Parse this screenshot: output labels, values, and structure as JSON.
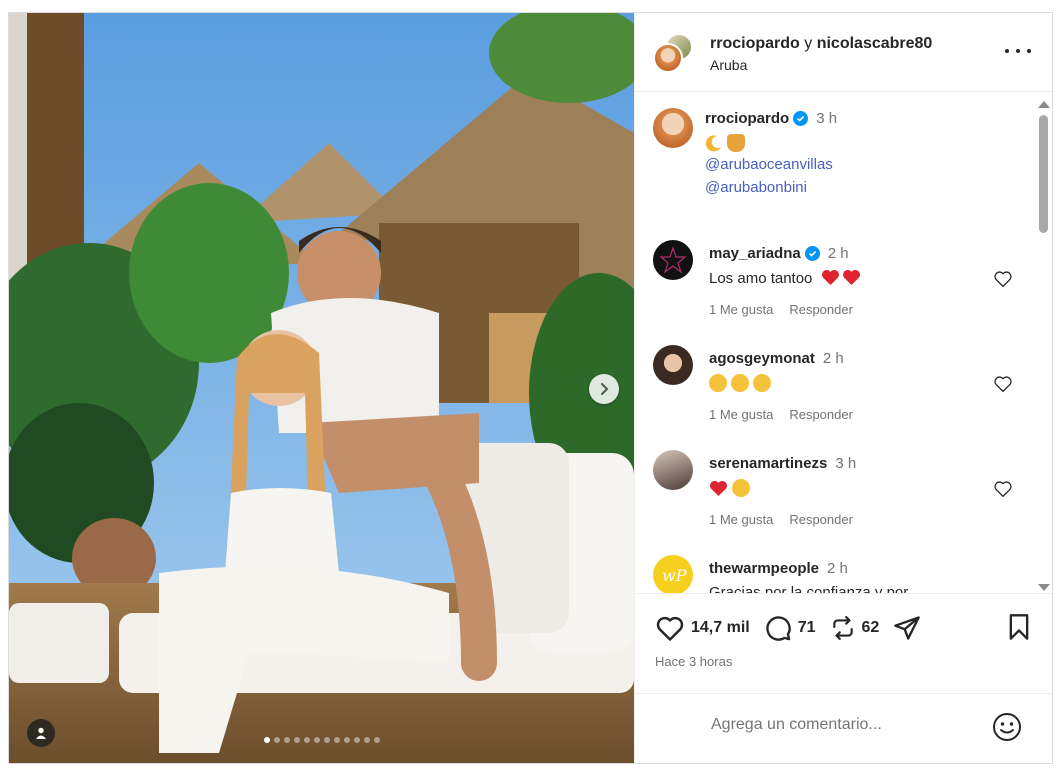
{
  "post": {
    "header": {
      "author_1": "rrociopardo",
      "connector": "y",
      "author_2": "nicolascabre80",
      "location": "Aruba"
    },
    "carousel": {
      "total_slides": 12,
      "active_slide": 1
    },
    "caption": {
      "username": "rrociopardo",
      "verified": true,
      "time": "3 h",
      "emojis": [
        "crescent-moon",
        "pot-of-honey"
      ],
      "mentions": [
        "@arubaoceanvillas",
        "@arubabonbini"
      ]
    },
    "comments": [
      {
        "username": "may_ariadna",
        "verified": true,
        "time": "2 h",
        "text": "Los amo tantoo",
        "emojis": [
          "red-heart",
          "red-heart"
        ],
        "likes": "1 Me gusta",
        "reply": "Responder"
      },
      {
        "username": "agosgeymonat",
        "verified": false,
        "time": "2 h",
        "text": "",
        "emojis": [
          "heart-eyes",
          "heart-eyes",
          "heart-eyes"
        ],
        "likes": "1 Me gusta",
        "reply": "Responder"
      },
      {
        "username": "serenamartinezs",
        "verified": false,
        "time": "3 h",
        "text": "",
        "emojis": [
          "red-heart",
          "heart-eyes"
        ],
        "likes": "1 Me gusta",
        "reply": "Responder"
      },
      {
        "username": "thewarmpeople",
        "verified": false,
        "time": "2 h",
        "text": "Gracias por la confianza y por",
        "emojis": [],
        "likes": "",
        "reply": ""
      }
    ],
    "actions": {
      "likes": "14,7 mil",
      "comments": "71",
      "reposts": "62"
    },
    "posted_ago": "Hace 3 horas",
    "add_comment_placeholder": "Agrega un comentario...",
    "colors": {
      "link": "#4a5fc1",
      "verified": "#0095f6",
      "heart": "#e0242f",
      "muted": "#737373"
    }
  }
}
